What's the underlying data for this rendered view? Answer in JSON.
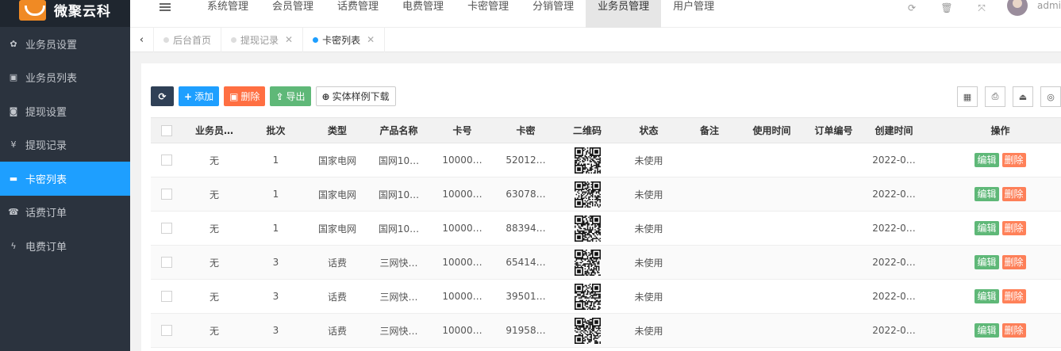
{
  "brand": {
    "name": "微聚云科"
  },
  "sidebar": {
    "items": [
      {
        "label": "业务员设置",
        "icon": "gear-icon"
      },
      {
        "label": "业务员列表",
        "icon": "id-card-icon"
      },
      {
        "label": "提现设置",
        "icon": "money-icon"
      },
      {
        "label": "提现记录",
        "icon": "yen-icon"
      },
      {
        "label": "卡密列表",
        "icon": "credit-card-icon",
        "active": true
      },
      {
        "label": "话费订单",
        "icon": "phone-icon"
      },
      {
        "label": "电费订单",
        "icon": "bolt-icon"
      }
    ]
  },
  "topnav": {
    "items": [
      "系统管理",
      "会员管理",
      "话费管理",
      "电费管理",
      "卡密管理",
      "分销管理",
      "业务员管理",
      "用户管理"
    ],
    "active_index": 6,
    "icons": [
      "refresh-icon",
      "trash-icon",
      "fullscreen-icon"
    ],
    "user": "admin"
  },
  "tabs": [
    {
      "label": "后台首页",
      "closable": false
    },
    {
      "label": "提现记录",
      "closable": true
    },
    {
      "label": "卡密列表",
      "closable": true,
      "active": true
    }
  ],
  "toolbar": {
    "add": "添加",
    "delete": "删除",
    "export": "导出",
    "download": "实体样例下载"
  },
  "table": {
    "headers": [
      "业务员…",
      "批次",
      "类型",
      "产品名称",
      "卡号",
      "卡密",
      "二维码",
      "状态",
      "备注",
      "使用时间",
      "订单编号",
      "创建时间",
      "操作"
    ],
    "edit_label": "编辑",
    "delete_label": "删除",
    "rows": [
      [
        "无",
        "1",
        "国家电网",
        "国网10…",
        "10000…",
        "52012…",
        "",
        "未使用",
        "",
        "",
        "",
        "2022-0…"
      ],
      [
        "无",
        "1",
        "国家电网",
        "国网10…",
        "10000…",
        "63078…",
        "",
        "未使用",
        "",
        "",
        "",
        "2022-0…"
      ],
      [
        "无",
        "1",
        "国家电网",
        "国网10…",
        "10000…",
        "88394…",
        "",
        "未使用",
        "",
        "",
        "",
        "2022-0…"
      ],
      [
        "无",
        "3",
        "话费",
        "三网快…",
        "10000…",
        "65414…",
        "",
        "未使用",
        "",
        "",
        "",
        "2022-0…"
      ],
      [
        "无",
        "3",
        "话费",
        "三网快…",
        "10000…",
        "39501…",
        "",
        "未使用",
        "",
        "",
        "",
        "2022-0…"
      ],
      [
        "无",
        "3",
        "话费",
        "三网快…",
        "10000…",
        "91958…",
        "",
        "未使用",
        "",
        "",
        "",
        "2022-0…"
      ]
    ]
  }
}
